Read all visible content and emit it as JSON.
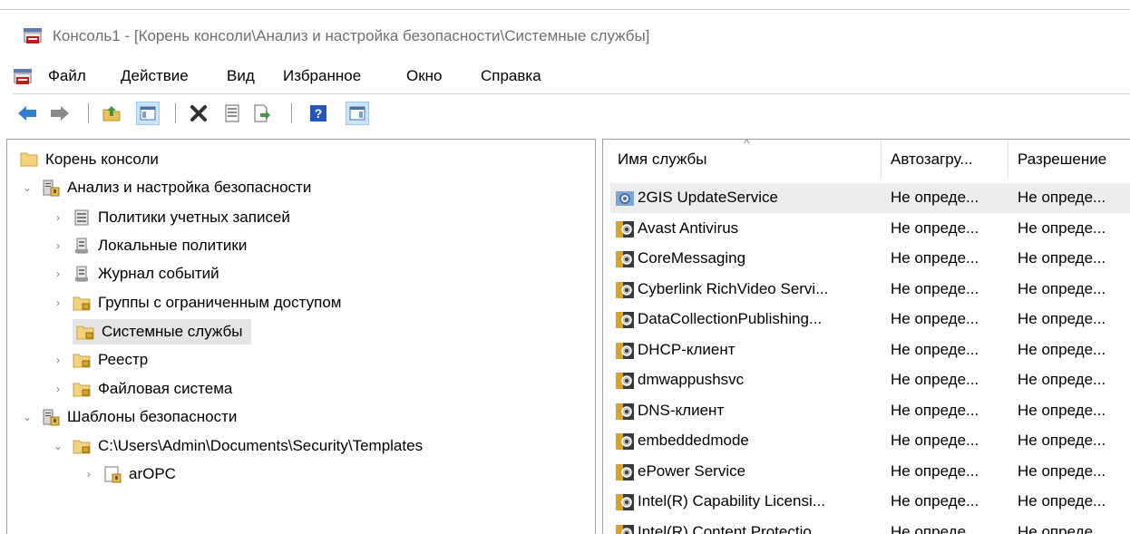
{
  "window": {
    "title": "Консоль1 - [Корень консоли\\Анализ и настройка безопасности\\Системные службы]"
  },
  "menu": {
    "items": [
      "Файл",
      "Действие",
      "Вид",
      "Избранное",
      "Окно",
      "Справка"
    ]
  },
  "toolbar": {
    "buttons": [
      "back-arrow-icon",
      "forward-arrow-icon",
      "up-folder-icon",
      "show-hide-tree-icon",
      "delete-icon",
      "properties-icon",
      "export-list-icon",
      "help-icon",
      "show-hide-action-pane-icon"
    ]
  },
  "tree": {
    "root": "Корень консоли",
    "analysis": "Анализ и настройка безопасности",
    "account_policies": "Политики учетных записей",
    "local_policies": "Локальные политики",
    "event_log": "Журнал событий",
    "restricted_groups": "Группы с ограниченным доступом",
    "system_services": "Системные службы",
    "registry": "Реестр",
    "file_system": "Файловая система",
    "templates": "Шаблоны безопасности",
    "templates_path": "C:\\Users\\Admin\\Documents\\Security\\Templates",
    "arOPC": "arOPC"
  },
  "list": {
    "columns": {
      "name": "Имя службы",
      "startup": "Автозагру...",
      "permission": "Разрешение"
    },
    "rows": [
      {
        "name": "2GIS UpdateService",
        "startup": "Не опреде...",
        "permission": "Не опреде..."
      },
      {
        "name": "Avast Antivirus",
        "startup": "Не опреде...",
        "permission": "Не опреде..."
      },
      {
        "name": "CoreMessaging",
        "startup": "Не опреде...",
        "permission": "Не опреде..."
      },
      {
        "name": "Cyberlink RichVideo Servi...",
        "startup": "Не опреде...",
        "permission": "Не опреде..."
      },
      {
        "name": "DataCollectionPublishing...",
        "startup": "Не опреде...",
        "permission": "Не опреде..."
      },
      {
        "name": "DHCP-клиент",
        "startup": "Не опреде...",
        "permission": "Не опреде..."
      },
      {
        "name": "dmwappushsvc",
        "startup": "Не опреде...",
        "permission": "Не опреде..."
      },
      {
        "name": "DNS-клиент",
        "startup": "Не опреде...",
        "permission": "Не опреде..."
      },
      {
        "name": "embeddedmode",
        "startup": "Не опреде...",
        "permission": "Не опреде..."
      },
      {
        "name": "ePower Service",
        "startup": "Не опреде...",
        "permission": "Не опреде..."
      },
      {
        "name": "Intel(R) Capability Licensi...",
        "startup": "Не опреде...",
        "permission": "Не опреде..."
      },
      {
        "name": "Intel(R) Content Protectio...",
        "startup": "Не опреде...",
        "permission": "Не опреде..."
      }
    ]
  }
}
